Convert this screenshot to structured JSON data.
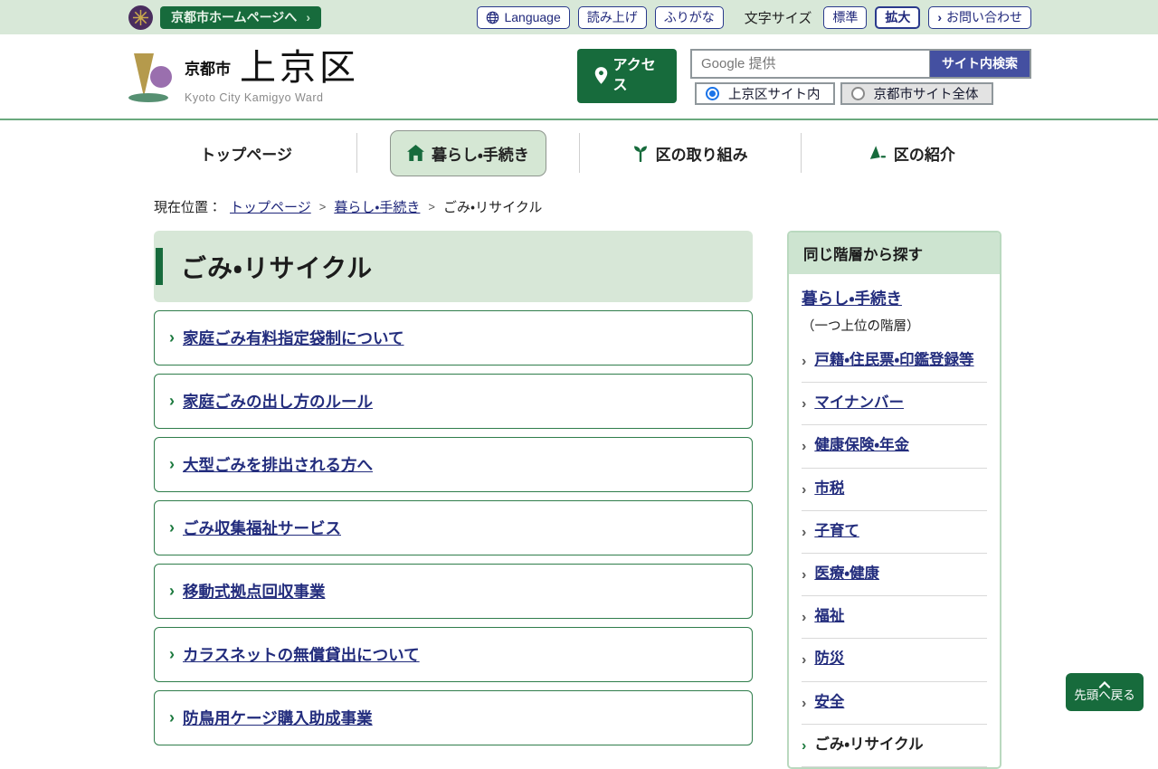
{
  "utility_bar": {
    "home_button": "京都市ホームページへ",
    "language_button": "Language",
    "read_aloud_button": "読み上げ",
    "furigana_button": "ふりがな",
    "font_size_label": "文字サイズ",
    "font_size_standard": "標準",
    "font_size_large": "拡大",
    "contact_button": "お問い合わせ"
  },
  "header": {
    "city_label": "京都市",
    "ward_label": "上京区",
    "ward_en": "Kyoto City Kamigyo Ward",
    "access_button": "アクセス",
    "search": {
      "placeholder": "Google 提供",
      "submit_label": "サイト内検索",
      "scope_ward": "上京区サイト内",
      "scope_city": "京都市サイト全体"
    }
  },
  "nav": {
    "items": [
      {
        "label": "トップページ",
        "icon": "none",
        "active": false
      },
      {
        "label": "暮らし・手続き",
        "icon": "home-icon",
        "active": true
      },
      {
        "label": "区の取り組み",
        "icon": "sprout-icon",
        "active": false
      },
      {
        "label": "区の紹介",
        "icon": "landmark-icon",
        "active": false
      }
    ]
  },
  "breadcrumb": {
    "prefix": "現在位置：",
    "items": [
      {
        "label": "トップページ",
        "is_link": true
      },
      {
        "label": "暮らし・手続き",
        "is_link": true
      },
      {
        "label": "ごみ・リサイクル",
        "is_link": false
      }
    ]
  },
  "main": {
    "page_title": "ごみ・リサイクル",
    "links": [
      {
        "label": "家庭ごみ有料指定袋制について"
      },
      {
        "label": "家庭ごみの出し方のルール"
      },
      {
        "label": "大型ごみを排出される方へ"
      },
      {
        "label": "ごみ収集福祉サービス"
      },
      {
        "label": "移動式拠点回収事業"
      },
      {
        "label": "カラスネットの無償貸出について"
      },
      {
        "label": "防鳥用ケージ購入助成事業"
      }
    ]
  },
  "sidebar": {
    "title": "同じ階層から探す",
    "parent_link": "暮らし・手続き",
    "parent_note": "（一つ上位の階層）",
    "items": [
      {
        "label": "戸籍・住民票・印鑑登録等",
        "current": false
      },
      {
        "label": "マイナンバー",
        "current": false
      },
      {
        "label": "健康保険・年金",
        "current": false
      },
      {
        "label": "市税",
        "current": false
      },
      {
        "label": "子育て",
        "current": false
      },
      {
        "label": "医療・健康",
        "current": false
      },
      {
        "label": "福祉",
        "current": false
      },
      {
        "label": "防災",
        "current": false
      },
      {
        "label": "安全",
        "current": false
      },
      {
        "label": "ごみ・リサイクル",
        "current": true
      }
    ]
  },
  "back_to_top": {
    "label": "先頭へ戻る"
  },
  "colors": {
    "green_dark": "#176b3c",
    "green_light_bar": "#d8e8d8",
    "green_title_bg": "#d7e7d7",
    "green_card_border": "#2f7d4b",
    "navy_link": "#232d7d",
    "navy_button_border": "#2a3a8c",
    "search_submit_bg": "#4450a1",
    "radio_selected": "#1a73e8",
    "sidebar_border": "#bad9bf",
    "emblem_purple": "#4a2d5e",
    "logo_gold": "#b59a4c",
    "logo_purple": "#9a6fae",
    "logo_green": "#569072"
  }
}
